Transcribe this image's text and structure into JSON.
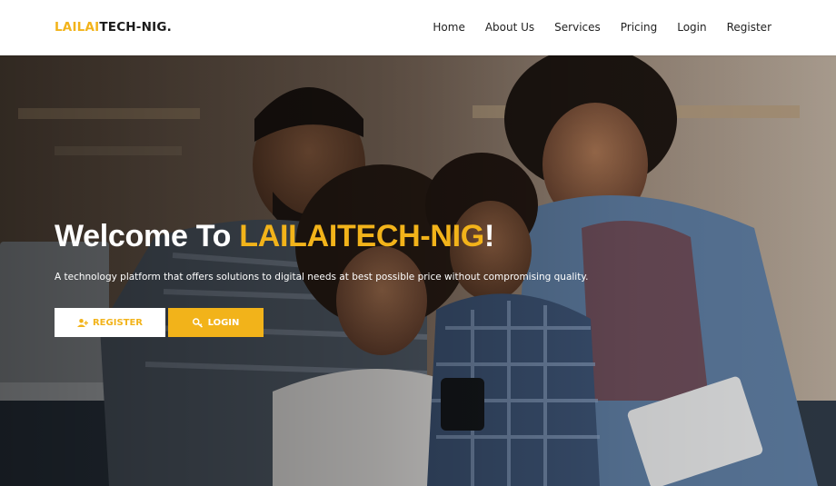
{
  "header": {
    "brand_prefix": "LAILAI",
    "brand_suffix": "TECH-NIG.",
    "nav": [
      {
        "label": "Home"
      },
      {
        "label": "About Us"
      },
      {
        "label": "Services"
      },
      {
        "label": "Pricing"
      },
      {
        "label": "Login"
      },
      {
        "label": "Register"
      }
    ]
  },
  "hero": {
    "title_prefix": "Welcome To ",
    "title_highlight": "LAILAITECH-NIG",
    "title_suffix": "!",
    "subtitle": "A technology platform that offers solutions to digital needs at best possible price without compromising quality.",
    "register_label": "REGISTER",
    "login_label": "LOGIN",
    "register_icon": "user-plus-icon",
    "login_icon": "key-icon"
  },
  "colors": {
    "accent": "#f2b31a",
    "nav_text": "#222222",
    "hero_text": "#ffffff"
  }
}
